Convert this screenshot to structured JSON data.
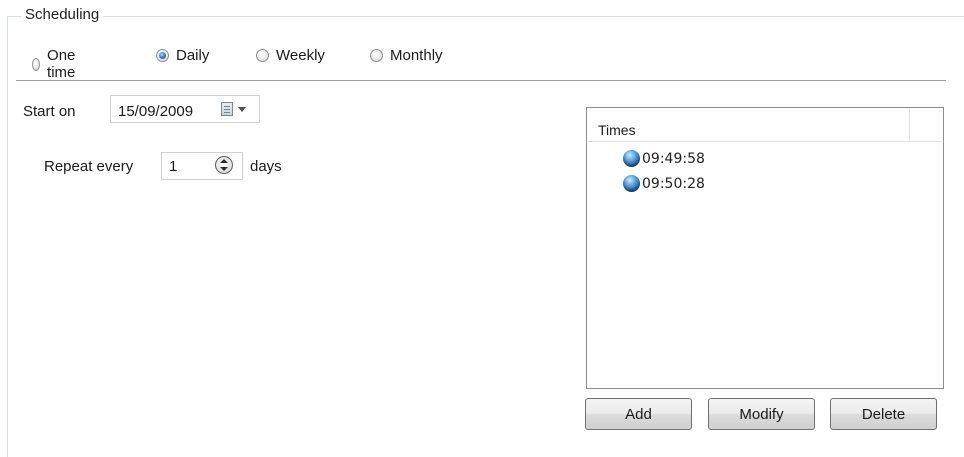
{
  "group_title": "Scheduling",
  "frequency": {
    "options": [
      "One time",
      "Daily",
      "Weekly",
      "Monthly"
    ],
    "selected": "Daily"
  },
  "start": {
    "label": "Start on",
    "date": "15/09/2009"
  },
  "repeat": {
    "label": "Repeat every",
    "value": "1",
    "unit": "days"
  },
  "times": {
    "header": "Times",
    "items": [
      "09:49:58",
      "09:50:28"
    ]
  },
  "buttons": {
    "add": "Add",
    "modify": "Modify",
    "delete": "Delete"
  },
  "icons": {
    "calendar": "calendar-icon",
    "time": "globe-time-icon",
    "spinner": "spinner-icon"
  }
}
